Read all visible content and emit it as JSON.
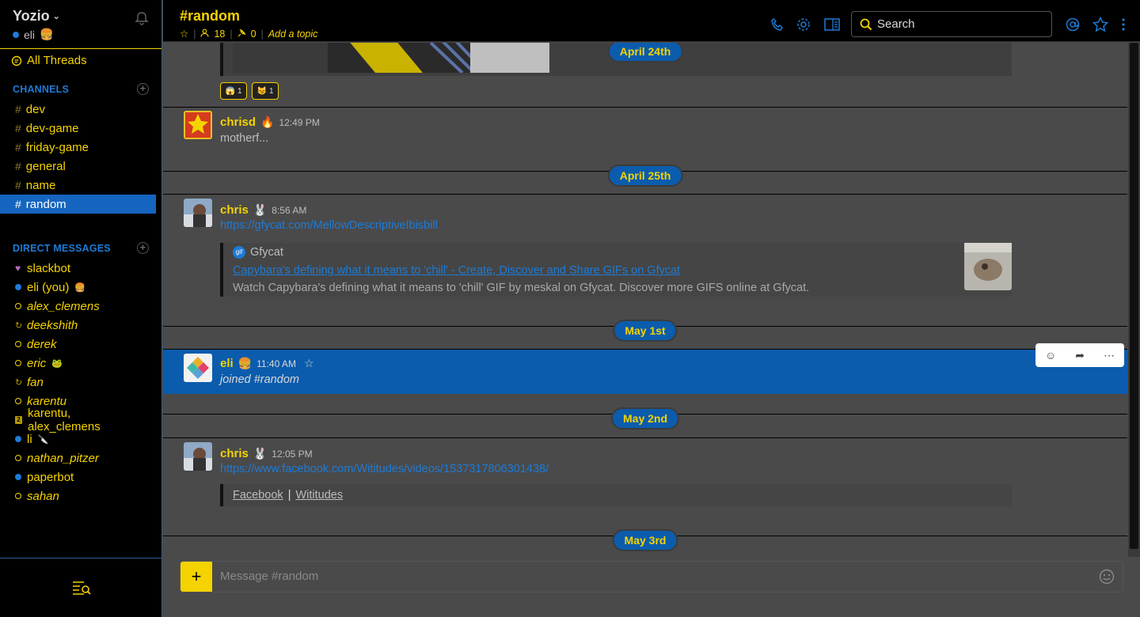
{
  "colors": {
    "accent": "#f5d300",
    "link": "#1e7bd6",
    "active": "#1565c0",
    "bg": "#4a4a4a"
  },
  "team": {
    "name": "Yozio",
    "user": "eli",
    "user_emoji": "🍔"
  },
  "sidebar": {
    "all_threads": "All Threads",
    "channels_title": "CHANNELS",
    "channels": [
      {
        "name": "dev"
      },
      {
        "name": "dev-game"
      },
      {
        "name": "friday-game"
      },
      {
        "name": "general"
      },
      {
        "name": "name"
      },
      {
        "name": "random"
      }
    ],
    "dm_title": "DIRECT MESSAGES",
    "dms": [
      {
        "name": "slackbot",
        "status": "heart",
        "emoji": ""
      },
      {
        "name": "eli (you)",
        "status": "online",
        "emoji": "🍔"
      },
      {
        "name": "alex_clemens",
        "status": "away",
        "emoji": ""
      },
      {
        "name": "deekshith",
        "status": "ghost",
        "emoji": ""
      },
      {
        "name": "derek",
        "status": "away",
        "emoji": ""
      },
      {
        "name": "eric",
        "status": "away",
        "emoji": "🐸"
      },
      {
        "name": "fan",
        "status": "ghost",
        "emoji": ""
      },
      {
        "name": "karentu",
        "status": "away",
        "emoji": ""
      },
      {
        "name": "karentu, alex_clemens",
        "status": "group",
        "emoji": ""
      },
      {
        "name": "li",
        "status": "online",
        "emoji": "🔪"
      },
      {
        "name": "nathan_pitzer",
        "status": "away",
        "emoji": ""
      },
      {
        "name": "paperbot",
        "status": "online",
        "emoji": ""
      },
      {
        "name": "sahan",
        "status": "away",
        "emoji": ""
      }
    ]
  },
  "header": {
    "channel": "#random",
    "members": "18",
    "pins": "0",
    "topic": "Add a topic",
    "search_placeholder": "Search"
  },
  "messages": {
    "date1": "April 24th",
    "reactions": [
      {
        "emoji": "😱",
        "count": "1"
      },
      {
        "emoji": "😼",
        "count": "1"
      }
    ],
    "m1": {
      "author": "chrisd",
      "author_emoji": "🔥",
      "time": "12:49 PM",
      "text": "motherf..."
    },
    "date2": "April 25th",
    "m2": {
      "author": "chris",
      "author_emoji": "🐰",
      "time": "8:56 AM",
      "link": "https://gfycat.com/MellowDescriptiveIbisbill",
      "attach_site": "Gfycat",
      "attach_title": "Capybara's defining what it means to 'chill' - Create, Discover and Share GIFs on Gfycat",
      "attach_desc": "Watch Capybara's defining what it means to 'chill' GIF by meskal on Gfycat. Discover more GIFS online at Gfycat."
    },
    "date3": "May 1st",
    "m3": {
      "author": "eli",
      "author_emoji": "🍔",
      "time": "11:40 AM",
      "text": "joined #random"
    },
    "date4": "May 2nd",
    "m4": {
      "author": "chris",
      "author_emoji": "🐰",
      "time": "12:05 PM",
      "link": "https://www.facebook.com/Wititudes/videos/1537317806301438/",
      "attach_a": "Facebook",
      "attach_sep": "|",
      "attach_b": "Wititudes"
    },
    "date5": "May 3rd"
  },
  "composer": {
    "placeholder": "Message #random"
  }
}
